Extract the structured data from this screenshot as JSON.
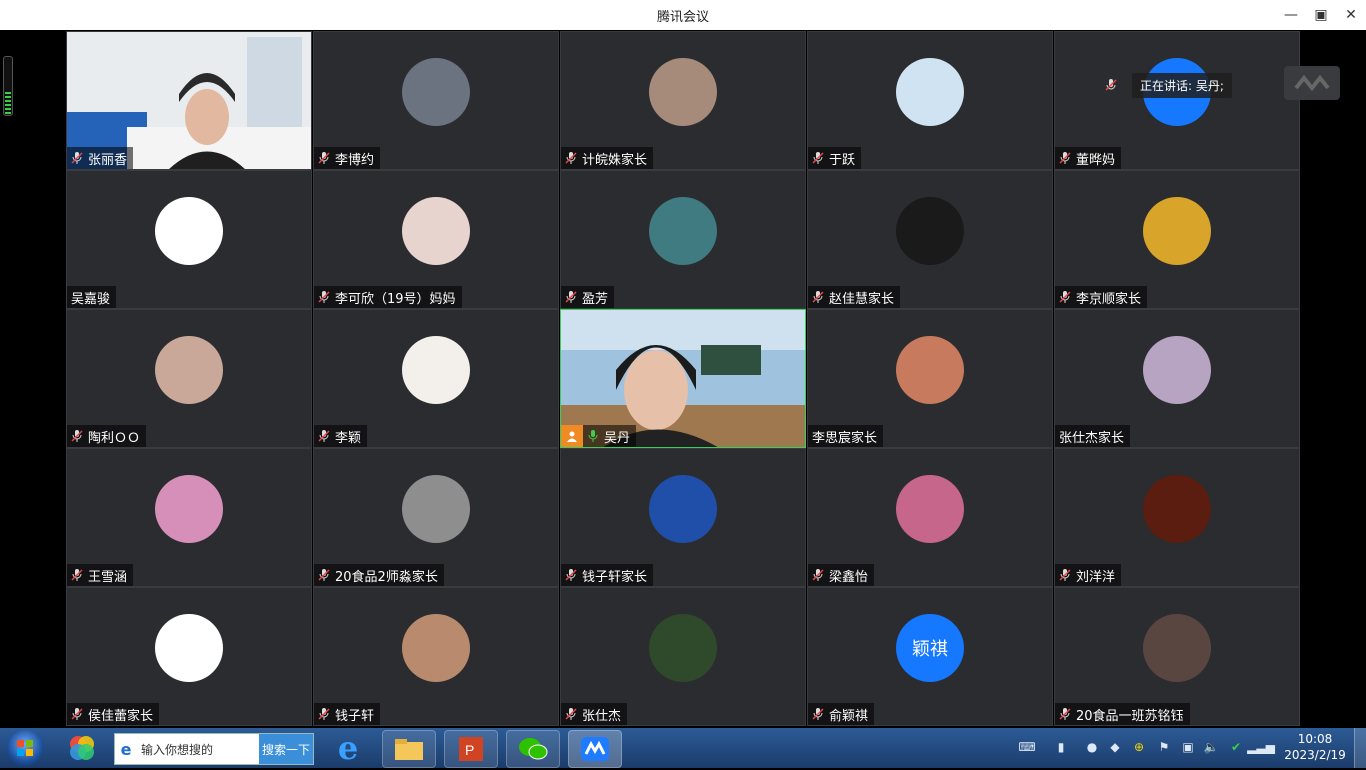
{
  "window": {
    "title": "腾讯会议"
  },
  "speaking": {
    "label": "正在讲话: 吴丹;"
  },
  "participants": [
    {
      "name": "张丽香",
      "type": "video",
      "muted": true
    },
    {
      "name": "李博约",
      "avatar_color": "#6b7280",
      "muted": true
    },
    {
      "name": "计皖姝家长",
      "avatar_color": "#a68a7a",
      "muted": true
    },
    {
      "name": "于跃",
      "avatar_color": "#cfe3f2",
      "muted": true
    },
    {
      "name": "董晔妈",
      "avatar_color": "#1677ff",
      "muted": true
    },
    {
      "name": "吴嘉骏",
      "avatar_color": "#ffffff",
      "muted": false
    },
    {
      "name": "李可欣（19号）妈妈",
      "avatar_color": "#e8d4cf",
      "muted": true
    },
    {
      "name": "盈芳",
      "avatar_color": "#3f7b80",
      "muted": true
    },
    {
      "name": "赵佳慧家长",
      "avatar_color": "#1a1a1a",
      "muted": true
    },
    {
      "name": "李京顺家长",
      "avatar_color": "#d8a52a",
      "muted": true
    },
    {
      "name": "陶利ＯＯ",
      "avatar_color": "#c9a89a",
      "muted": true
    },
    {
      "name": "李颖",
      "avatar_color": "#f3efea",
      "muted": true
    },
    {
      "name": "吴丹",
      "type": "video",
      "muted": false,
      "host": true,
      "active": true
    },
    {
      "name": "李思宸家长",
      "avatar_color": "#c77a5e",
      "muted": false
    },
    {
      "name": "张仕杰家长",
      "avatar_color": "#b6a4c2",
      "muted": false
    },
    {
      "name": "王雪涵",
      "avatar_color": "#d58fb8",
      "muted": true
    },
    {
      "name": "20食品2师淼家长",
      "avatar_color": "#8e8e8e",
      "muted": true
    },
    {
      "name": "钱子轩家长",
      "avatar_color": "#1f4fa8",
      "muted": true
    },
    {
      "name": "梁鑫怡",
      "avatar_color": "#c5668a",
      "muted": true
    },
    {
      "name": "刘洋洋",
      "avatar_color": "#5a1d10",
      "muted": true
    },
    {
      "name": "侯佳蕾家长",
      "avatar_color": "#ffffff",
      "muted": true
    },
    {
      "name": "钱子轩",
      "avatar_color": "#b98a6e",
      "muted": true
    },
    {
      "name": "张仕杰",
      "avatar_color": "#2f4a2a",
      "muted": true
    },
    {
      "name": "俞颖祺",
      "avatar_color": "#1677ff",
      "avatar_text": "颖祺",
      "muted": true
    },
    {
      "name": "20食品一班苏铭钰",
      "avatar_color": "#5a4640",
      "muted": true
    }
  ],
  "taskbar": {
    "search_placeholder": "输入你想搜的",
    "search_button": "搜索一下",
    "time": "10:08",
    "date": "2023/2/19"
  }
}
